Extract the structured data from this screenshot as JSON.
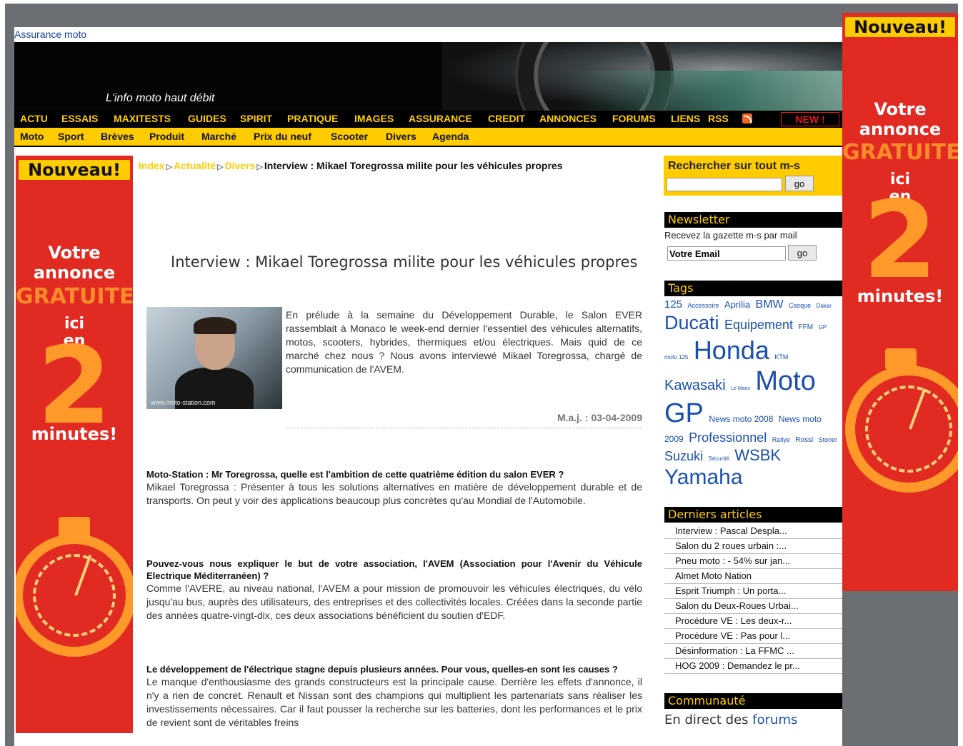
{
  "header": {
    "top_link": "Assurance moto",
    "tagline": "L'info moto haut débit",
    "nav_main": [
      "ACTU",
      "ESSAIS",
      "MAXITESTS",
      "GUIDES",
      "SPIRIT",
      "PRATIQUE",
      "IMAGES",
      "ASSURANCE",
      "CREDIT",
      "ANNONCES",
      "FORUMS",
      "LIENS",
      "RSS"
    ],
    "new_badge": "NEW !",
    "nav_sub": [
      "Moto",
      "Sport",
      "Brèves",
      "Produit",
      "Marché",
      "Prix du neuf",
      "Scooter",
      "Divers",
      "Agenda"
    ]
  },
  "ad": {
    "nouveau": "Nouveau!",
    "line1": "Votre",
    "line2": "annonce",
    "gratuite": "GRATUITE",
    "ici": "ici",
    "en": "en",
    "two": "2",
    "minutes": "minutes!"
  },
  "breadcrumb": {
    "index": "Index",
    "actualite": "Actualité",
    "divers": "Divers",
    "current": "Interview : Mikael Toregrossa milite pour les véhicules propres"
  },
  "article": {
    "title": "Interview : Mikael Toregrossa milite pour les véhicules propres",
    "photo_caption": "www.moto-station.com",
    "intro": "En prélude à la semaine du Développement Durable, le Salon EVER rassemblait à Monaco le week-end dernier l'essentiel des véhicules alternatifs, motos, scooters, hybrides, thermiques et/ou électriques. Mais quid de ce marché chez nous ? Nous avons interviewé Mikael Toregrossa, chargé de communication de l'AVEM.",
    "maj": "M.a.j. : 03-04-2009",
    "qa": [
      {
        "q": "Moto-Station : Mr Toregrossa, quelle est l'ambition de cette quatrième édition du salon EVER ?",
        "a": "Mikael Toregrossa : Présenter à tous les solutions alternatives en matière de développement durable et de transports. On peut y voir des applications beaucoup plus concrètes qu'au Mondial de l'Automobile."
      },
      {
        "q": "Pouvez-vous nous expliquer le but de votre association, l'AVEM (Association pour l'Avenir du Véhicule Electrique Méditerranéen) ?",
        "a": "Comme l'AVERE, au niveau national, l'AVEM a pour mission de promouvoir les véhicules électriques, du vélo jusqu'au bus, auprès des utilisateurs, des entreprises et des collectivités locales. Créées dans la seconde partie des années quatre-vingt-dix, ces deux associations bénéficient du soutien d'EDF."
      },
      {
        "q": "Le développement de l'électrique stagne depuis plusieurs années. Pour vous, quelles-en sont les causes ?",
        "a": "Le manque d'enthousiasme des grands constructeurs est la principale cause. Derrière les effets d'annonce, il n'y a rien de concret. Renault et Nissan sont des champions qui multiplient les partenariats sans réaliser les investissements nécessaires. Car il faut pousser la recherche sur les batteries, dont les performances et le prix de revient sont de véritables freins"
      }
    ]
  },
  "sidebar": {
    "search_title": "Rechercher sur tout m-s",
    "go": "go",
    "newsletter_head": "Newsletter",
    "newsletter_text": "Recevez la gazette m-s par mail",
    "newsletter_input": "Votre Email",
    "tags_head": "Tags",
    "tags": [
      {
        "label": "125",
        "size": 15
      },
      {
        "label": "Accessoire",
        "size": 9
      },
      {
        "label": "Aprilia",
        "size": 13
      },
      {
        "label": "BMW",
        "size": 16
      },
      {
        "label": "Casque",
        "size": 9
      },
      {
        "label": "Dakar",
        "size": 8
      },
      {
        "label": "Ducati",
        "size": 27
      },
      {
        "label": "Equipement",
        "size": 18
      },
      {
        "label": "FFM",
        "size": 10
      },
      {
        "label": "GP",
        "size": 8
      },
      {
        "label": "moto 125",
        "size": 8
      },
      {
        "label": "Honda",
        "size": 36
      },
      {
        "label": "KTM",
        "size": 9
      },
      {
        "label": "Kawasaki",
        "size": 20
      },
      {
        "label": "Le Mans",
        "size": 7
      },
      {
        "label": "Moto GP",
        "size": 38
      },
      {
        "label": "News moto 2008",
        "size": 12
      },
      {
        "label": "News moto 2009",
        "size": 12
      },
      {
        "label": "Professionnel",
        "size": 18
      },
      {
        "label": "Rallye",
        "size": 9
      },
      {
        "label": "Rossi",
        "size": 10
      },
      {
        "label": "Stoner",
        "size": 9
      },
      {
        "label": "Suzuki",
        "size": 18
      },
      {
        "label": "Sécurité",
        "size": 8
      },
      {
        "label": "WSBK",
        "size": 22
      },
      {
        "label": "Yamaha",
        "size": 30
      }
    ],
    "recent_head": "Derniers articles",
    "recent": [
      "Interview : Pascal Despla...",
      "Salon du 2 roues urbain :...",
      "Pneu moto : - 54% sur jan...",
      "Almet Moto Nation",
      "Esprit Triumph : Un porta...",
      "Salon du Deux-Roues Urbai...",
      "Procédure VE : Les deux-r...",
      "Procédure VE : Pas pour l...",
      "Désinformation : La FFMC ...",
      "HOG 2009 : Demandez le pr..."
    ],
    "community_head": "Communauté",
    "community_text": "En direct des",
    "community_link": "forums"
  }
}
